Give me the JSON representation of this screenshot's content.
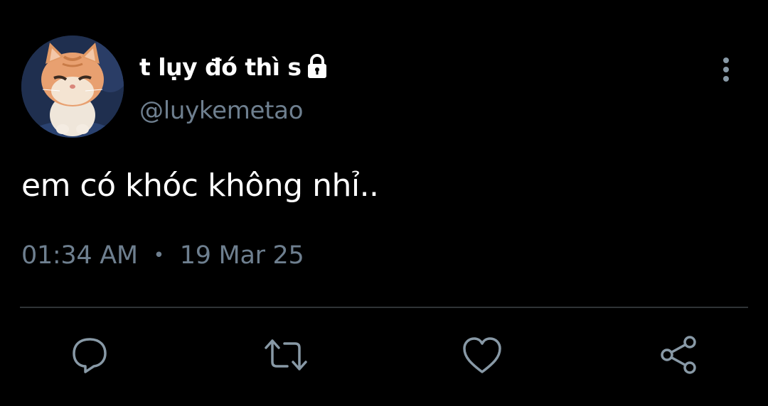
{
  "tweet": {
    "display_name": "t lụy đó thì s",
    "handle": "@luykemetao",
    "text": "em có khóc không nhỉ..",
    "time": "01:34 AM",
    "separator": "•",
    "date": "19 Mar 25",
    "protected": true
  },
  "icons": {
    "lock": "lock-icon",
    "more": "more-vertical-icon",
    "reply": "reply-icon",
    "retweet": "retweet-icon",
    "like": "heart-icon",
    "share": "share-icon"
  },
  "colors": {
    "background": "#000000",
    "text_primary": "#ffffff",
    "text_secondary": "#6e7f8f",
    "icon": "#8899a6",
    "divider": "#2f3336"
  }
}
